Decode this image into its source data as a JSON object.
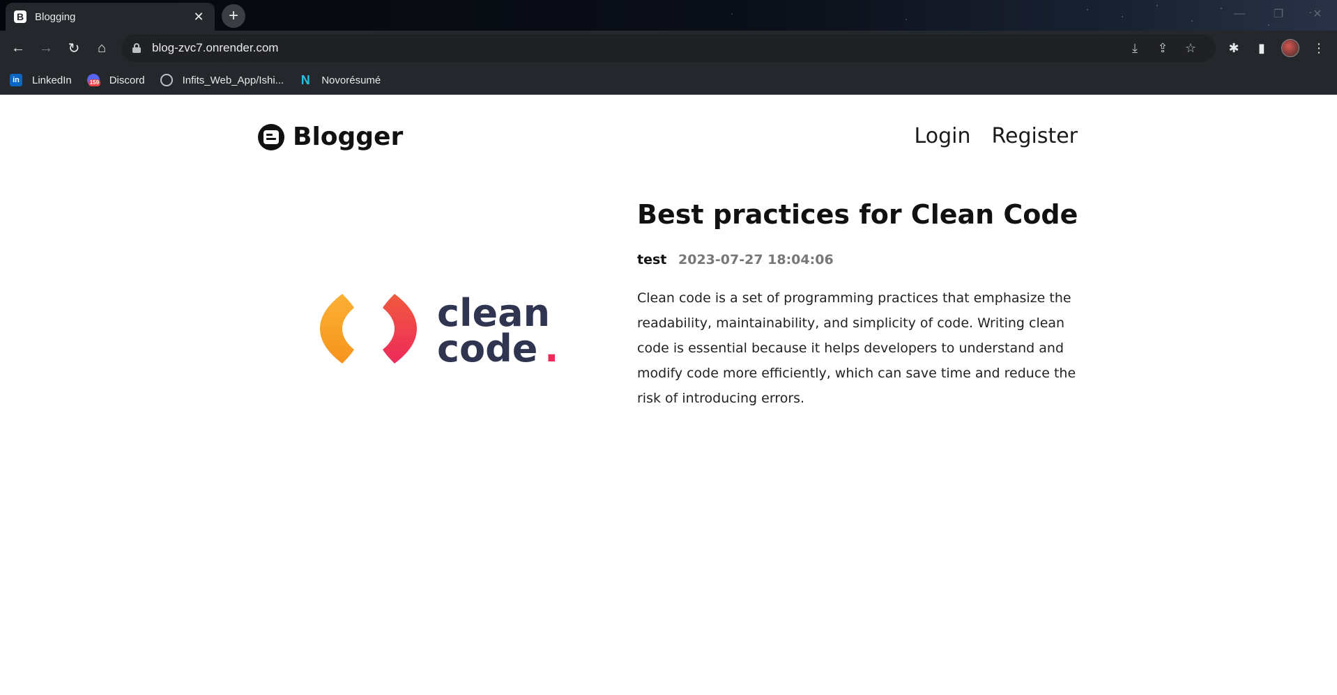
{
  "browser": {
    "tab": {
      "title": "Blogging",
      "close_glyph": "✕",
      "favicon_letter": "B"
    },
    "newtab_glyph": "+",
    "window_controls": [
      "—",
      "❐",
      "✕"
    ],
    "nav_glyphs": {
      "back": "←",
      "forward": "→",
      "reload": "↻",
      "home": "⌂"
    },
    "url": "blog-zvc7.onrender.com",
    "omnibox_icons": {
      "install": "⤓",
      "share": "⇪",
      "bookmark": "☆"
    },
    "toolbar_icons": {
      "extensions": "✱",
      "sidepanel": "▮",
      "menu": "⋮"
    },
    "bookmarks": [
      {
        "label": "LinkedIn",
        "icon": "in"
      },
      {
        "label": "Discord",
        "badge": "159"
      },
      {
        "label": "Infits_Web_App/Ishi..."
      },
      {
        "label": "Novorésumé",
        "icon": "N"
      }
    ]
  },
  "site": {
    "brand": "Blogger",
    "nav": {
      "login": "Login",
      "register": "Register"
    }
  },
  "post": {
    "title": "Best practices for Clean Code",
    "author": "test",
    "date": "2023-07-27 18:04:06",
    "body": "Clean code is a set of programming practices that emphasize the readability, maintainability, and simplicity of code. Writing clean code is essential because it helps developers to understand and modify code more efficiently, which can save time and reduce the risk of introducing errors.",
    "image": {
      "line1": "clean",
      "line2": "code",
      "dot": "."
    }
  },
  "colors": {
    "logo_text": "#2f3450",
    "logo_orange": "#f7941d",
    "logo_pink": "#ee2a5b",
    "chrome_bg": "#24272c"
  }
}
